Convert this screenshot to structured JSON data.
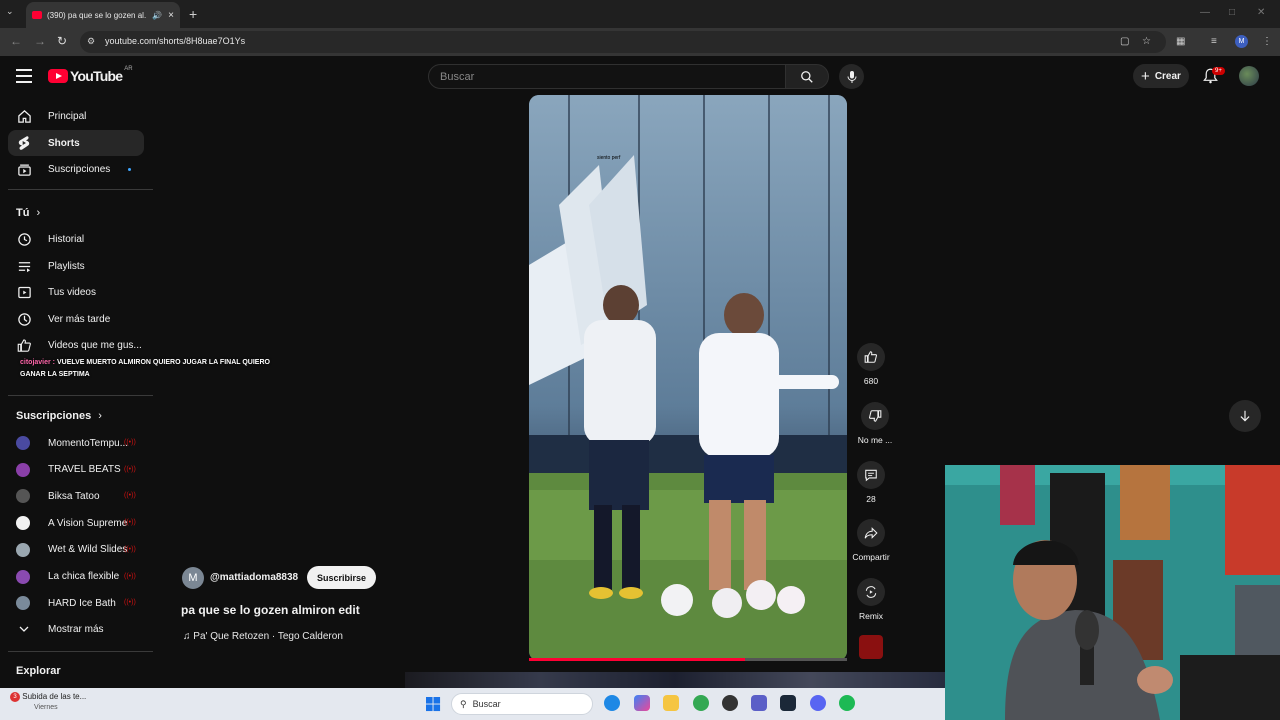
{
  "browser": {
    "tab_title": "(390) pa que se lo gozen al...",
    "url": "youtube.com/shorts/8H8uae7O1Ys",
    "profile_initial": "M"
  },
  "header": {
    "logo_text": "YouTube",
    "country_code": "AR",
    "search_placeholder": "Buscar",
    "create_label": "Crear",
    "notification_badge": "9+"
  },
  "sidebar": {
    "main": [
      {
        "label": "Principal",
        "icon": "home-icon"
      },
      {
        "label": "Shorts",
        "icon": "shorts-icon"
      },
      {
        "label": "Suscripciones",
        "icon": "subscriptions-icon"
      }
    ],
    "you_heading": "Tú",
    "you_items": [
      {
        "label": "Historial",
        "icon": "history-icon"
      },
      {
        "label": "Playlists",
        "icon": "playlists-icon"
      },
      {
        "label": "Tus videos",
        "icon": "your-videos-icon"
      },
      {
        "label": "Ver más tarde",
        "icon": "watch-later-icon"
      },
      {
        "label": "Videos que me gus...",
        "icon": "like-icon"
      }
    ],
    "chat_user": "citojavier :",
    "chat_message": "VUELVE MUERTO ALMIRON QUIERO JUGAR LA FINAL QUIERO GANAR LA SEPTIMA",
    "subs_heading": "Suscripciones",
    "channels": [
      {
        "name": "MomentoTempu...",
        "color": "#4a4aa0"
      },
      {
        "name": "TRAVEL BEATS",
        "color": "#8a3fa8"
      },
      {
        "name": "Biksa Tatoo",
        "color": "#555555"
      },
      {
        "name": "A Vision Supreme",
        "color": "#f1f1f1"
      },
      {
        "name": "Wet & Wild Slides",
        "color": "#9aa7b0"
      },
      {
        "name": "La chica flexible",
        "color": "#8a4ab0"
      },
      {
        "name": "HARD Ice Bath",
        "color": "#7a8a9a"
      }
    ],
    "show_more": "Mostrar más",
    "explore_heading": "Explorar"
  },
  "video": {
    "overlay_text": "siento perf",
    "progress": 0.68,
    "likes": "680",
    "dislike_label": "No me ...",
    "comments": "28",
    "share_label": "Compartir",
    "remix_label": "Remix",
    "channel_initial": "M",
    "channel_handle": "@mattiadoma8838",
    "subscribe_label": "Suscribirse",
    "title": "pa que se lo gozen almiron edit",
    "song": "Pa' Que Retozen · Tego Calderon"
  },
  "taskbar": {
    "notification_title": "Subida de las te...",
    "notification_sub": "Viernes",
    "notification_count": "3",
    "search_label": "Buscar"
  }
}
